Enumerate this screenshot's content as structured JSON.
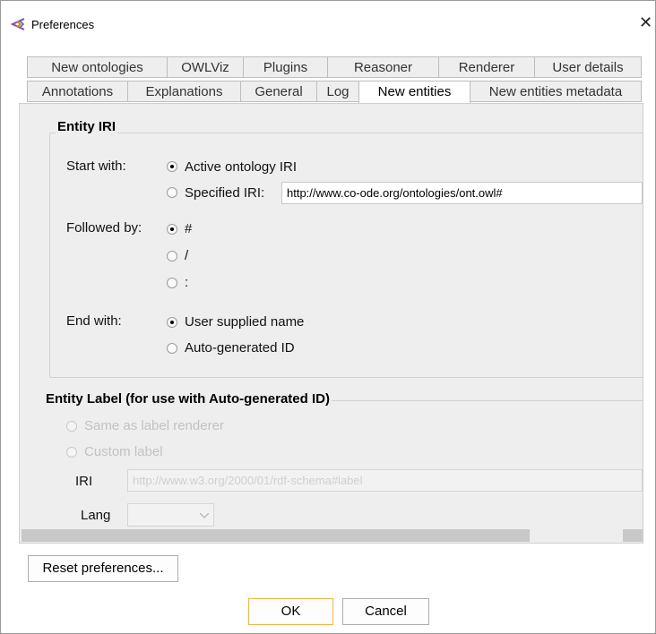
{
  "window": {
    "title": "Preferences",
    "close_label": "✕"
  },
  "tabs_row1": [
    "New ontologies",
    "OWLViz",
    "Plugins",
    "Reasoner",
    "Renderer",
    "User details"
  ],
  "tabs_row2": [
    "Annotations",
    "Explanations",
    "General",
    "Log",
    "New entities",
    "New entities metadata"
  ],
  "active_tab": "New entities",
  "entity_iri": {
    "title": "Entity IRI",
    "start_with_label": "Start with:",
    "start_options": [
      "Active ontology IRI",
      "Specified IRI:"
    ],
    "start_selected": "Active ontology IRI",
    "specified_iri_value": "http://www.co-ode.org/ontologies/ont.owl#",
    "followed_by_label": "Followed by:",
    "followed_options": [
      "#",
      "/",
      ":"
    ],
    "followed_selected": "#",
    "end_with_label": "End with:",
    "end_options": [
      "User supplied name",
      "Auto-generated ID"
    ],
    "end_selected": "User supplied name"
  },
  "entity_label": {
    "title": "Entity Label (for use with Auto-generated ID)",
    "options": [
      "Same as label renderer",
      "Custom label"
    ],
    "selected": "Same as label renderer",
    "iri_label": "IRI",
    "iri_value": "http://www.w3.org/2000/01/rdf-schema#label",
    "lang_label": "Lang",
    "lang_value": ""
  },
  "buttons": {
    "reset": "Reset preferences...",
    "ok": "OK",
    "cancel": "Cancel"
  }
}
